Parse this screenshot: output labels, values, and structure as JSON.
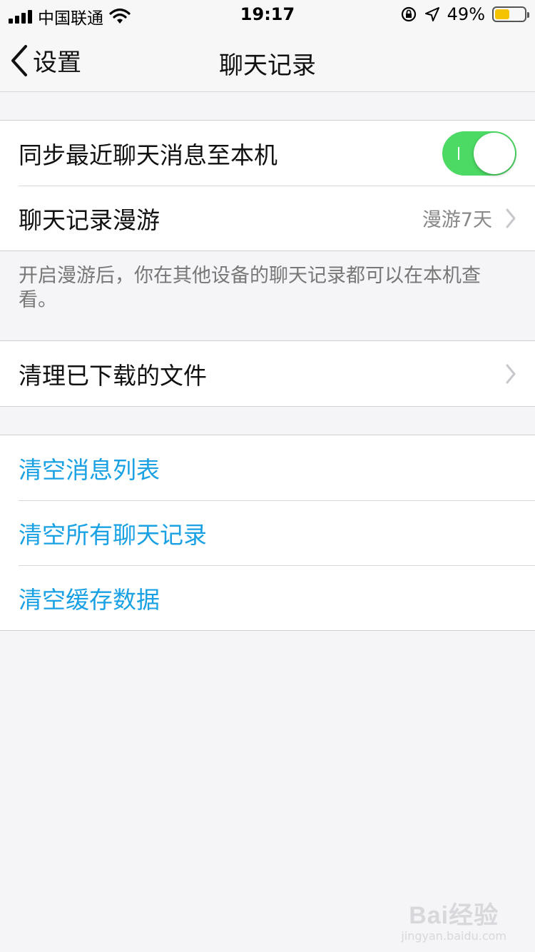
{
  "status_bar": {
    "carrier": "中国联通",
    "time": "19:17",
    "battery_percent": "49%",
    "battery_level": 0.49,
    "icons": [
      "signal-icon",
      "wifi-icon",
      "orientation-lock-icon",
      "location-icon",
      "battery-icon"
    ]
  },
  "nav": {
    "back_label": "设置",
    "title": "聊天记录"
  },
  "sync_group": {
    "sync_label": "同步最近聊天消息至本机",
    "sync_enabled": true,
    "roaming_label": "聊天记录漫游",
    "roaming_value": "漫游7天"
  },
  "footnote": "开启漫游后，你在其他设备的聊天记录都可以在本机查看。",
  "files_group": {
    "clean_files_label": "清理已下载的文件"
  },
  "clear_group": {
    "clear_messages": "清空消息列表",
    "clear_all_chats": "清空所有聊天记录",
    "clear_cache": "清空缓存数据"
  },
  "watermark": {
    "logo": "Bai经验",
    "url": "jingyan.baidu.com"
  },
  "colors": {
    "toggle_on": "#4cd964",
    "action_blue": "#1aa1e4",
    "background": "#f5f5f7",
    "battery_fill": "#f5c400"
  }
}
